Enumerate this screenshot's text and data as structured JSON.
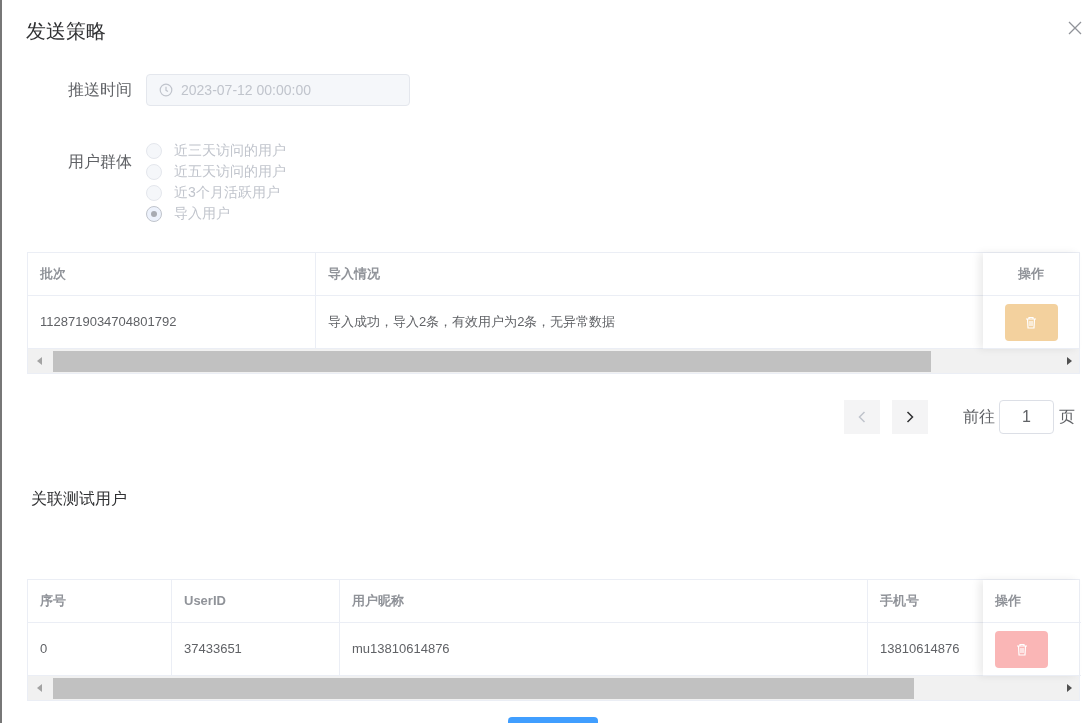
{
  "dialog": {
    "title": "发送策略"
  },
  "push_time": {
    "label": "推送时间",
    "value": "2023-07-12 00:00:00"
  },
  "user_group": {
    "label": "用户群体",
    "options": [
      {
        "label": "近三天访问的用户",
        "selected": false
      },
      {
        "label": "近五天访问的用户",
        "selected": false
      },
      {
        "label": "近3个月活跃用户",
        "selected": false
      },
      {
        "label": "导入用户",
        "selected": true
      }
    ]
  },
  "import_table": {
    "columns": [
      "批次",
      "导入情况"
    ],
    "action_column": "操作",
    "rows": [
      {
        "cells": [
          "1128719034704801792",
          "导入成功，导入2条，有效用户为2条，无异常数据"
        ]
      }
    ]
  },
  "pagination": {
    "goto_label": "前往",
    "page": "1",
    "page_suffix": "页"
  },
  "test_users": {
    "title": "关联测试用户",
    "columns": [
      "序号",
      "UserID",
      "用户昵称",
      "手机号"
    ],
    "action_column": "操作",
    "rows": [
      {
        "cells": [
          "0",
          "37433651",
          "mu13810614876",
          "13810614876"
        ]
      }
    ]
  }
}
